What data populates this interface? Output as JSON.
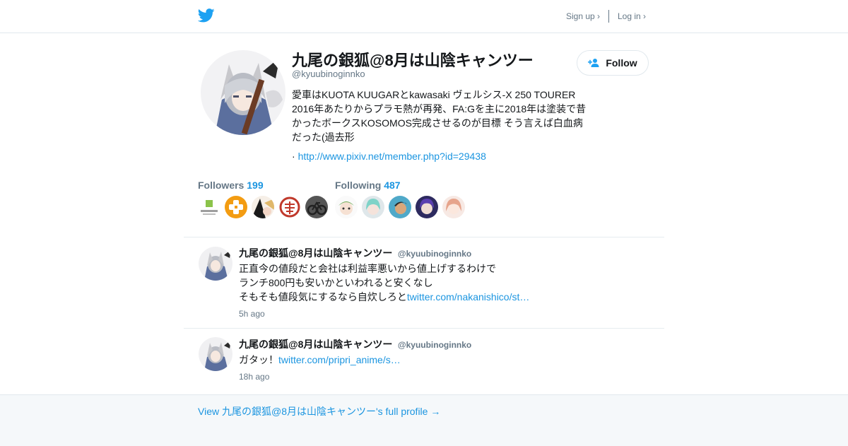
{
  "header": {
    "logo_icon": "twitter-bird-icon",
    "signup_label": "Sign up ›",
    "login_label": "Log in ›",
    "brand_color": "#1da1f2"
  },
  "profile": {
    "display_name": "九尾の銀狐@8月は山陰キャンツー",
    "screen_name": "@kyuubinoginnko",
    "bio": "愛車はKUOTA KUUGARとkawasaki ヴェルシス-X 250 TOURER 2016年あたりからプラモ熱が再発、FA:Gを主に2018年は塗装で昔かったボークスKOSOMOS完成させるのが目標 そう言えば白血病だった(過去形",
    "url_prefix": "·",
    "url": "http://www.pixiv.net/member.php?id=29438",
    "follow_label": "Follow",
    "follow_icon": "add-user-icon"
  },
  "stats": {
    "followers_label": "Followers",
    "followers_count": "199",
    "following_label": "Following",
    "following_count": "487"
  },
  "tweets": [
    {
      "name": "九尾の銀狐@8月は山陰キャンツー",
      "handle": "@kyuubinoginnko",
      "lines": [
        "正直今の値段だと会社は利益率悪いから値上げするわけで",
        "ランチ800円も安いかといわれると安くなし",
        "そもそも値段気にするなら自炊しろと"
      ],
      "link": "twitter.com/nakanishico/st…",
      "time": "5h ago"
    },
    {
      "name": "九尾の銀狐@8月は山陰キャンツー",
      "handle": "@kyuubinoginnko",
      "lines": [
        "ガタッ！"
      ],
      "link": "twitter.com/pripri_anime/s…",
      "time": "18h ago"
    }
  ],
  "footer": {
    "full_profile_label": "View 九尾の銀狐@8月は山陰キャンツー's full profile →"
  },
  "colors": {
    "link": "#1b95e0",
    "muted": "#657786",
    "text": "#14171a",
    "footer_bg": "#f5f8fa"
  }
}
